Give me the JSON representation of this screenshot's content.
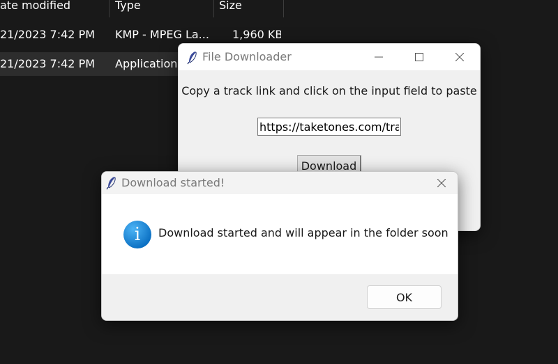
{
  "explorer": {
    "columns": {
      "date": "ate modified",
      "type": "Type",
      "size": "Size"
    },
    "rows": [
      {
        "date": "21/2023 7:42 PM",
        "type": "KMP - MPEG La...",
        "size": "1,960 KB"
      },
      {
        "date": "21/2023 7:42 PM",
        "type": "Application",
        "size": ""
      }
    ]
  },
  "downloader": {
    "title": "File Downloader",
    "icon": "feather-icon",
    "instruction": "Copy a track link and click on the input field to paste",
    "url_value": "https://taketones.com/track",
    "download_label": "Download"
  },
  "started": {
    "title": "Download started!",
    "icon": "info-icon",
    "message": "Download started and will appear in the folder soon",
    "ok_label": "OK"
  },
  "colors": {
    "background": "#191919",
    "info_blue": "#0a6fc2"
  }
}
